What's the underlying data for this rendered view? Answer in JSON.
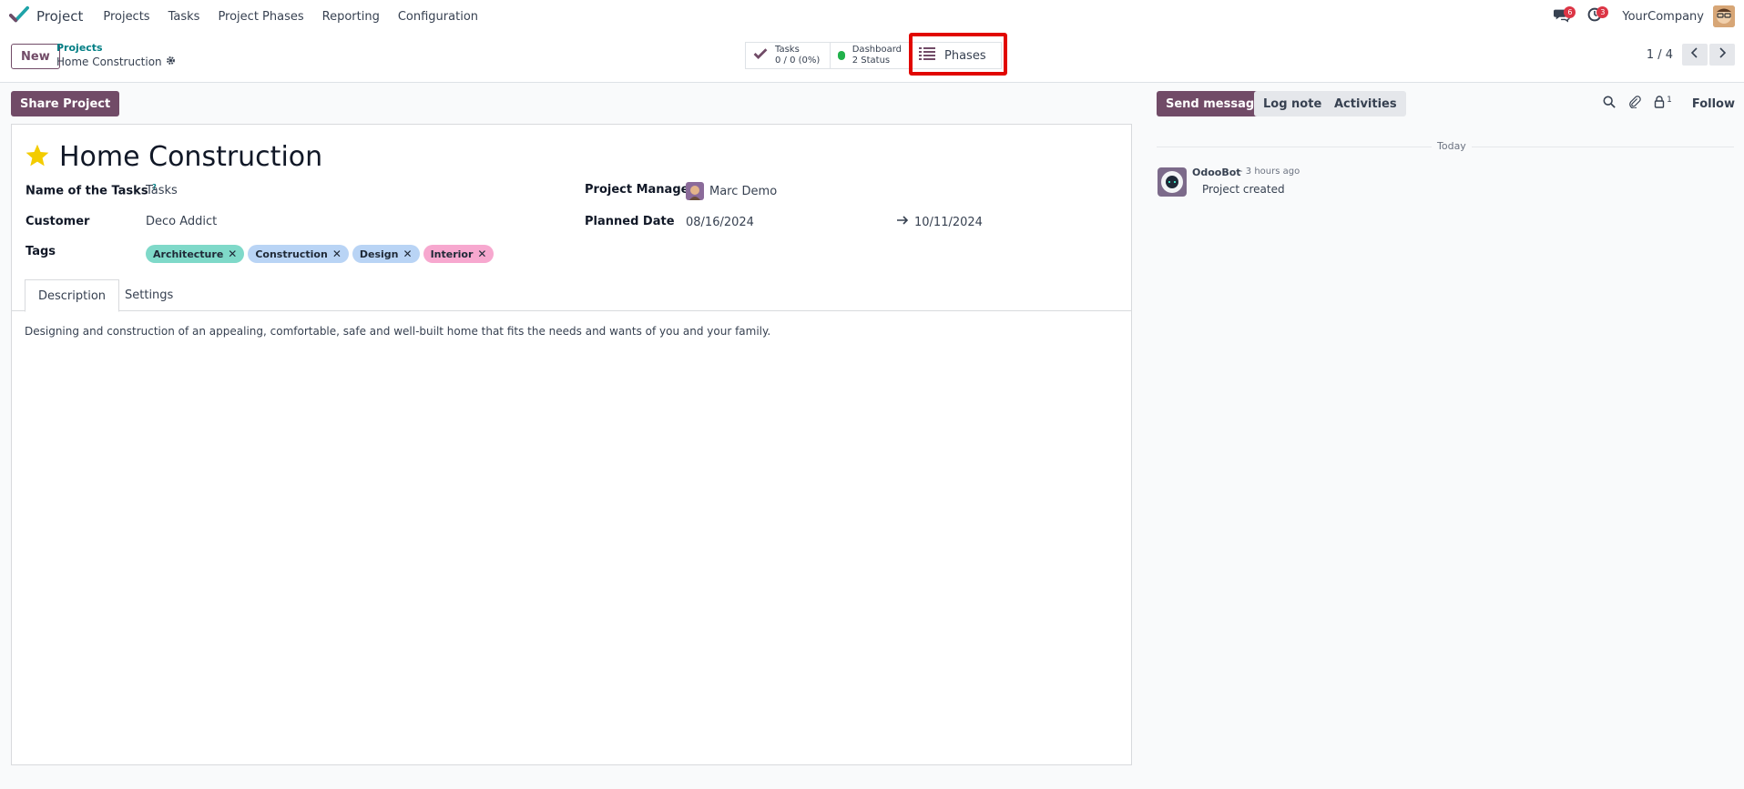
{
  "navbar": {
    "app_name": "Project",
    "menu": [
      "Projects",
      "Tasks",
      "Project Phases",
      "Reporting",
      "Configuration"
    ],
    "messages_count": "6",
    "activities_count": "3",
    "company": "YourCompany"
  },
  "control": {
    "new_label": "New",
    "breadcrumb_parent": "Projects",
    "breadcrumb_current": "Home Construction",
    "stats": {
      "tasks_label": "Tasks",
      "tasks_value": "0 / 0 (0%)",
      "dashboard_label": "Dashboard",
      "dashboard_value": "2 Status",
      "phases_label": "Phases"
    },
    "pager": "1 / 4"
  },
  "form": {
    "share_label": "Share Project",
    "title": "Home Construction",
    "fields": {
      "tasks_name_label": "Name of the Tasks",
      "tasks_name_help": "?",
      "tasks_name_value": "Tasks",
      "customer_label": "Customer",
      "customer_value": "Deco Addict",
      "tags_label": "Tags",
      "manager_label": "Project Manager",
      "manager_value": "Marc Demo",
      "planned_label": "Planned Date",
      "planned_start": "08/16/2024",
      "planned_end": "10/11/2024"
    },
    "tags": [
      {
        "label": "Architecture",
        "color": "#7fd9c9"
      },
      {
        "label": "Construction",
        "color": "#b9d4f5"
      },
      {
        "label": "Design",
        "color": "#b9d4f5"
      },
      {
        "label": "Interior",
        "color": "#f7a8cf"
      }
    ],
    "tabs": [
      "Description",
      "Settings"
    ],
    "description": "Designing and construction of an appealing, comfortable, safe and well-built home that fits the needs and wants of you and your family."
  },
  "chatter": {
    "send_message": "Send message",
    "log_note": "Log note",
    "activities": "Activities",
    "followers_count": "1",
    "follow": "Follow",
    "divider": "Today",
    "message": {
      "author": "OdooBot",
      "time": "- 3 hours ago",
      "body": "Project created"
    }
  },
  "colors": {
    "primary": "#714b67",
    "link": "#017e84",
    "highlight": "#e10600",
    "star": "#f3cc00"
  }
}
